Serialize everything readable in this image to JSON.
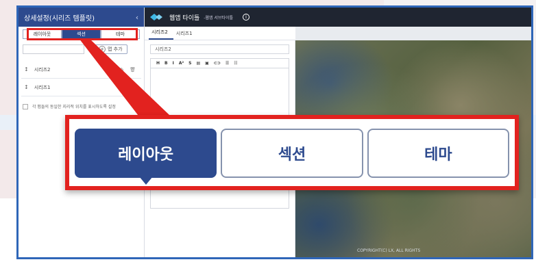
{
  "sidebar": {
    "title": "상세설정(시리즈 템플릿)",
    "collapse_icon": "‹",
    "tabs": [
      {
        "label": "레이아웃",
        "active": false
      },
      {
        "label": "섹션",
        "active": true
      },
      {
        "label": "테마",
        "active": false
      }
    ],
    "add_button_label": "맵 추가",
    "items": [
      {
        "label": "시리즈2"
      },
      {
        "label": "시리즈1"
      }
    ],
    "checkbox_label": "각 맵들의 동일한 지리적 위치를 표시하도록 설정"
  },
  "topbar": {
    "title": "웹앱 타이틀",
    "subtitle": "-웹앱 서브타이틀",
    "info_icon": "i"
  },
  "series_tabs": [
    {
      "label": "시리즈2",
      "active": true
    },
    {
      "label": "시리즈1",
      "active": false
    }
  ],
  "editor": {
    "title_value": "시리즈2",
    "toolbar": [
      "H",
      "B",
      "I",
      "A²",
      "S",
      "▤",
      "▣",
      "⊂⊃",
      "☰",
      "☷"
    ]
  },
  "map": {
    "copyright": "COPYRIGHT(C) LX, ALL RIGHTS"
  },
  "zoom": {
    "tabs": [
      {
        "label": "레이아웃",
        "active": true
      },
      {
        "label": "섹션",
        "active": false
      },
      {
        "label": "테마",
        "active": false
      }
    ]
  },
  "colors": {
    "primary": "#2d4a8e",
    "highlight": "#e2221f",
    "window_border": "#2f66b8"
  }
}
